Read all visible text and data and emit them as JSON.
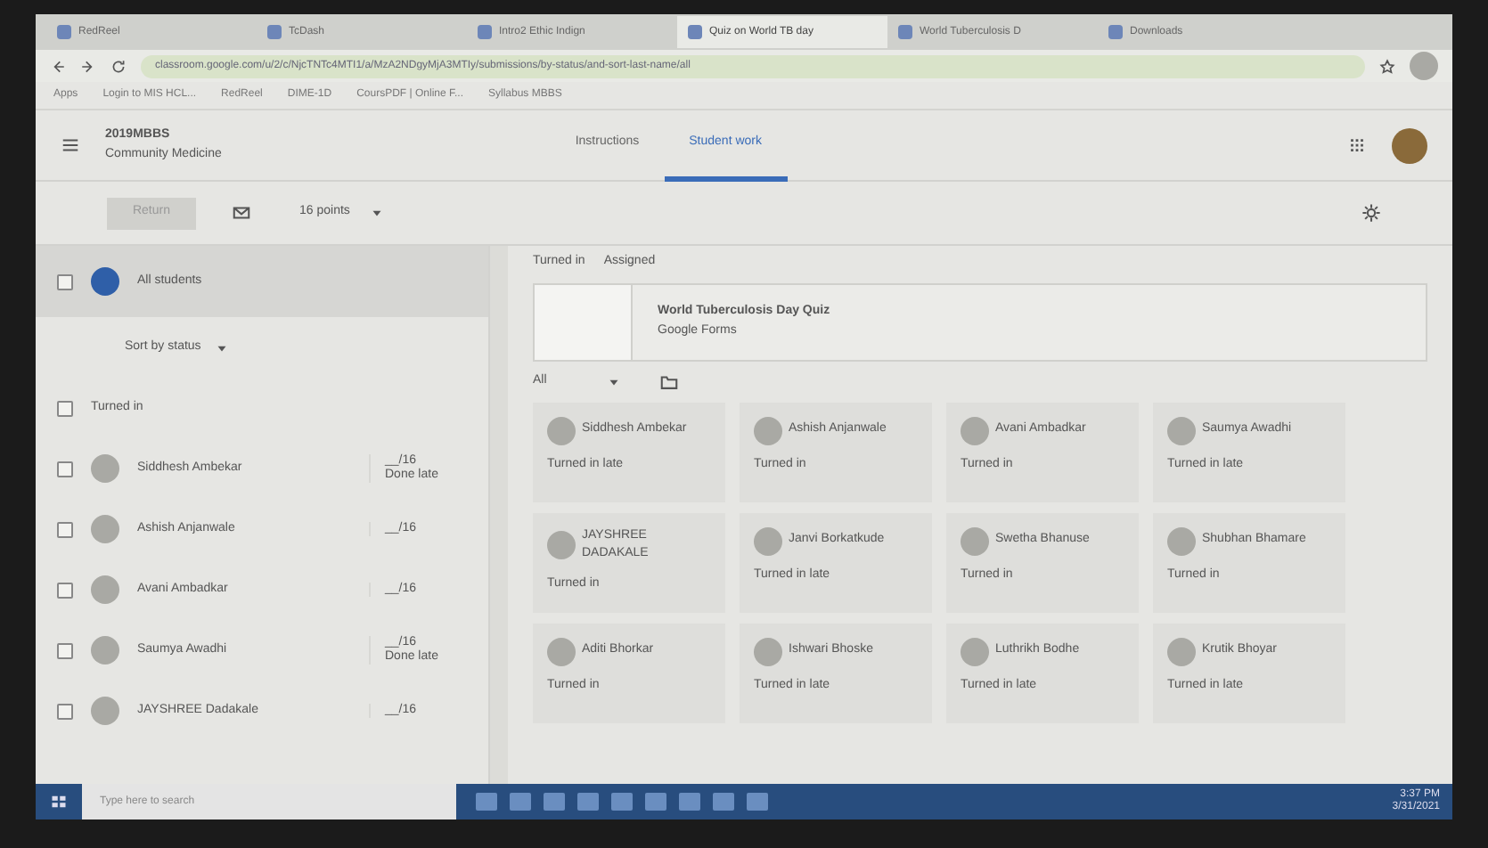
{
  "browser_tabs": [
    {
      "title": "RedReel",
      "selected": false
    },
    {
      "title": "TcDash",
      "selected": false
    },
    {
      "title": "Intro2 Ethic Indign",
      "selected": false
    },
    {
      "title": "Quiz on World TB day",
      "selected": true
    },
    {
      "title": "World Tuberculosis D",
      "selected": false
    },
    {
      "title": "Downloads",
      "selected": false
    }
  ],
  "address": "classroom.google.com/u/2/c/NjcTNTc4MTI1/a/MzA2NDgyMjA3MTIy/submissions/by-status/and-sort-last-name/all",
  "bookmarks": [
    "Apps",
    "Login to MIS HCL...",
    "RedReel",
    "DIME-1D",
    "CoursPDF | Online F...",
    "Syllabus MBBS"
  ],
  "course": {
    "title": "2019MBBS",
    "subtitle": "Community Medicine"
  },
  "page_tabs": [
    {
      "label": "Instructions",
      "selected": false
    },
    {
      "label": "Student work",
      "selected": true
    }
  ],
  "toolbar": {
    "return_button": "Return",
    "points": "16 points"
  },
  "roster": {
    "all_checked": false,
    "group_checked": false,
    "all_label": "All students",
    "sort_label": "Sort by status",
    "group_label": "Turned in",
    "students": [
      {
        "name": "Siddhesh Ambekar",
        "grade": "__/16",
        "note": "Done late",
        "checked": false
      },
      {
        "name": "Ashish Anjanwale",
        "grade": "__/16",
        "checked": false
      },
      {
        "name": "Avani Ambadkar",
        "grade": "__/16",
        "checked": false
      },
      {
        "name": "Saumya Awadhi",
        "grade": "__/16",
        "note": "Done late",
        "checked": false
      },
      {
        "name": "JAYSHREE Dadakale",
        "grade": "__/16",
        "checked": false
      }
    ]
  },
  "summary": [
    {
      "label": "Turned in"
    },
    {
      "label": "Assigned"
    }
  ],
  "assignment": {
    "title": "World Tuberculosis Day Quiz",
    "subtitle": "Google Forms"
  },
  "filter": "All",
  "cards": [
    {
      "name": "Siddhesh Ambekar",
      "status": "Turned in late"
    },
    {
      "name": "Ashish Anjanwale",
      "status": "Turned in"
    },
    {
      "name": "Avani Ambadkar",
      "status": "Turned in"
    },
    {
      "name": "Saumya Awadhi",
      "status": "Turned in late"
    },
    {
      "name": "JAYSHREE DADAKALE",
      "status": "Turned in"
    },
    {
      "name": "Janvi Borkatkude",
      "status": "Turned in late"
    },
    {
      "name": "Swetha Bhanuse",
      "status": "Turned in"
    },
    {
      "name": "Shubhan Bhamare",
      "status": "Turned in"
    },
    {
      "name": "Aditi Bhorkar",
      "status": "Turned in"
    },
    {
      "name": "Ishwari Bhoske",
      "status": "Turned in late"
    },
    {
      "name": "Luthrikh Bodhe",
      "status": "Turned in late"
    },
    {
      "name": "Krutik Bhoyar",
      "status": "Turned in late"
    }
  ],
  "taskbar": {
    "search_placeholder": "Type here to search",
    "time": "3:37 PM",
    "date": "3/31/2021"
  }
}
